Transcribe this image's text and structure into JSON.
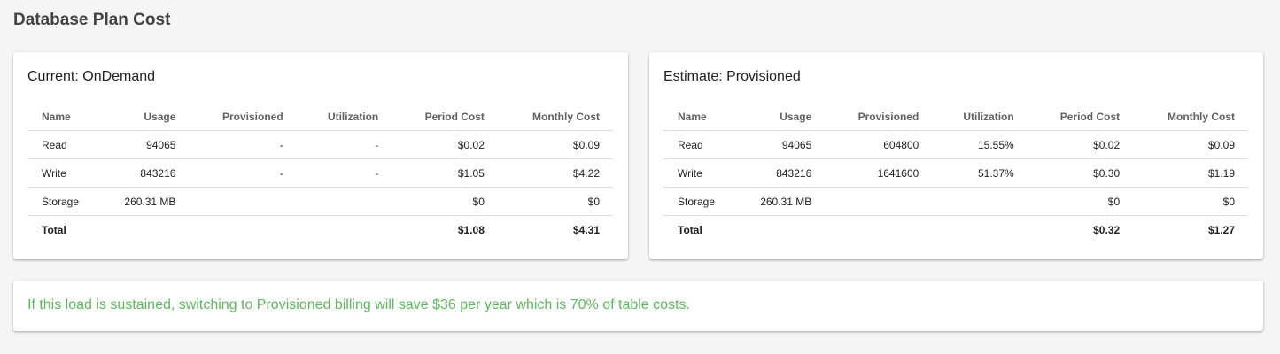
{
  "page": {
    "title": "Database Plan Cost"
  },
  "columns": [
    "Name",
    "Usage",
    "Provisioned",
    "Utilization",
    "Period Cost",
    "Monthly Cost"
  ],
  "current": {
    "title": "Current: OnDemand",
    "rows": [
      [
        "Read",
        "94065",
        "-",
        "-",
        "$0.02",
        "$0.09"
      ],
      [
        "Write",
        "843216",
        "-",
        "-",
        "$1.05",
        "$4.22"
      ],
      [
        "Storage",
        "260.31 MB",
        "",
        "",
        "$0",
        "$0"
      ]
    ],
    "total": [
      "Total",
      "",
      "",
      "",
      "$1.08",
      "$4.31"
    ]
  },
  "estimate": {
    "title": "Estimate: Provisioned",
    "rows": [
      [
        "Read",
        "94065",
        "604800",
        "15.55%",
        "$0.02",
        "$0.09"
      ],
      [
        "Write",
        "843216",
        "1641600",
        "51.37%",
        "$0.30",
        "$1.19"
      ],
      [
        "Storage",
        "260.31 MB",
        "",
        "",
        "$0",
        "$0"
      ]
    ],
    "total": [
      "Total",
      "",
      "",
      "",
      "$0.32",
      "$1.27"
    ]
  },
  "summary": {
    "text": "If this load is sustained, switching to Provisioned billing will save $36 per year which is 70% of table costs.",
    "color": "#5cb85c"
  }
}
